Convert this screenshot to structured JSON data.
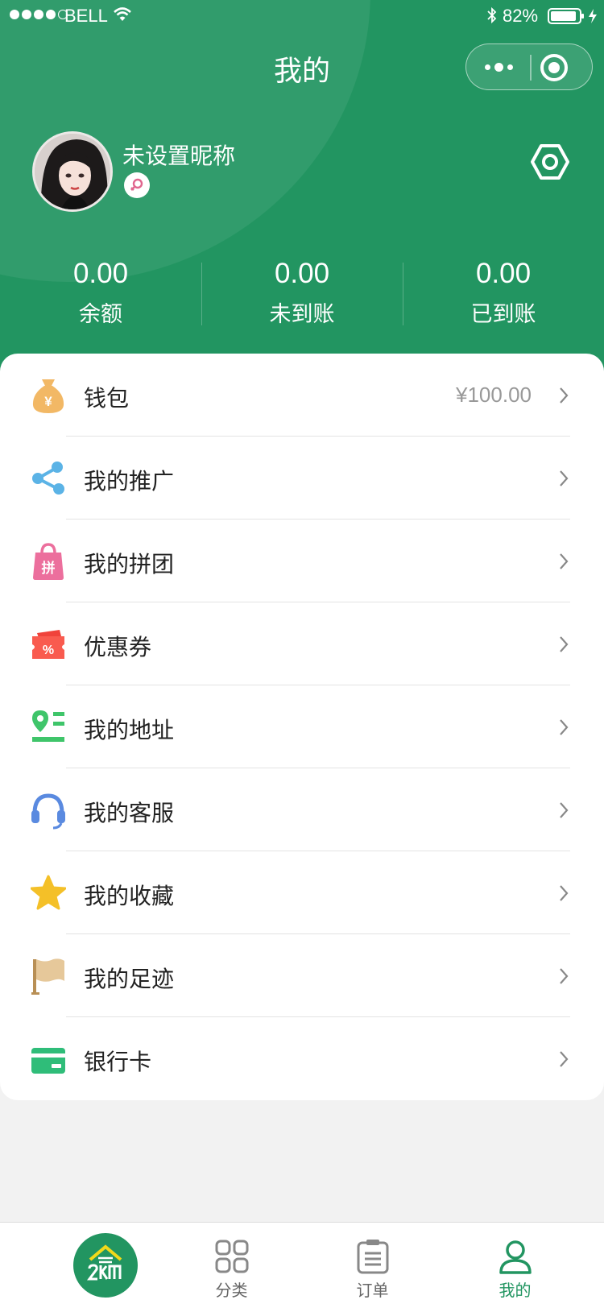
{
  "status_bar": {
    "carrier": "BELL",
    "battery": "82%"
  },
  "header": {
    "title": "我的"
  },
  "profile": {
    "nickname": "未设置昵称"
  },
  "stats": [
    {
      "value": "0.00",
      "label": "余额"
    },
    {
      "value": "0.00",
      "label": "未到账"
    },
    {
      "value": "0.00",
      "label": "已到账"
    }
  ],
  "menu": [
    {
      "label": "钱包",
      "value": "¥100.00",
      "icon": "wallet-bag-icon"
    },
    {
      "label": "我的推广",
      "icon": "share-icon"
    },
    {
      "label": "我的拼团",
      "icon": "group-buy-bag-icon"
    },
    {
      "label": "优惠券",
      "icon": "coupon-icon"
    },
    {
      "label": "我的地址",
      "icon": "address-pin-icon"
    },
    {
      "label": "我的客服",
      "icon": "headset-icon"
    },
    {
      "label": "我的收藏",
      "icon": "star-icon"
    },
    {
      "label": "我的足迹",
      "icon": "flag-icon"
    },
    {
      "label": "银行卡",
      "icon": "bank-card-icon"
    }
  ],
  "tabs": [
    {
      "label": "",
      "icon": "home-logo-icon"
    },
    {
      "label": "分类",
      "icon": "category-grid-icon"
    },
    {
      "label": "订单",
      "icon": "order-clipboard-icon"
    },
    {
      "label": "我的",
      "icon": "user-icon",
      "active": true
    }
  ],
  "colors": {
    "brand": "#229561",
    "text": "#222222",
    "muted": "#999999"
  }
}
